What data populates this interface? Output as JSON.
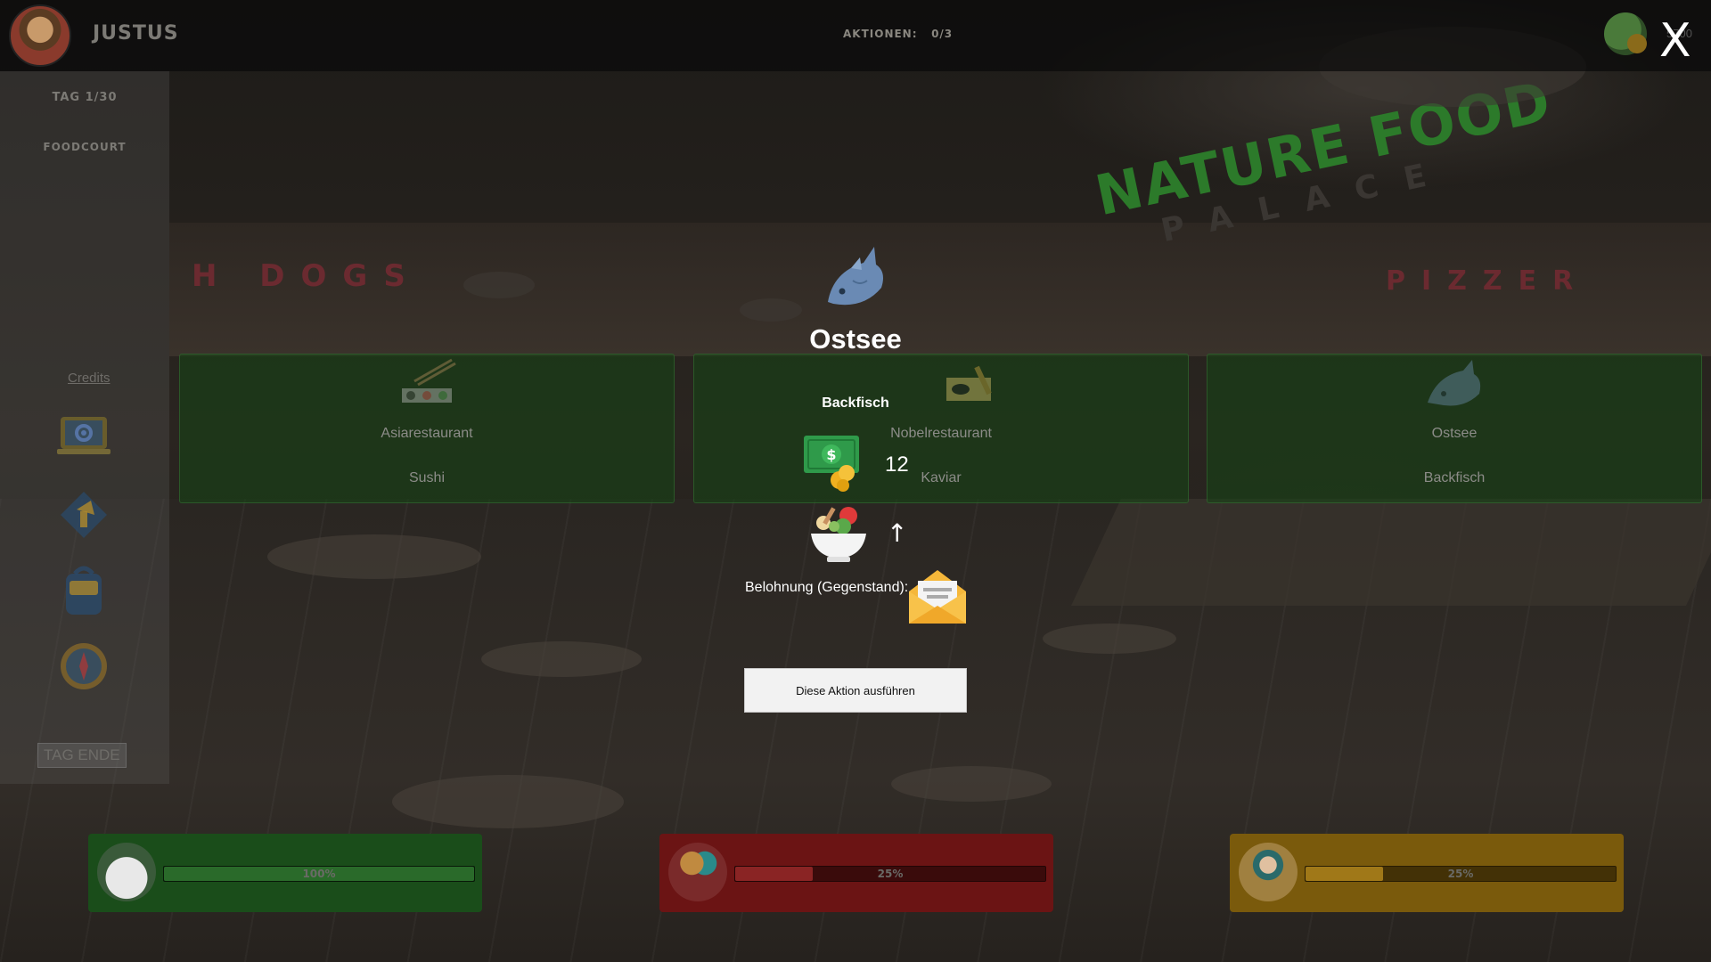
{
  "topbar": {
    "player_name": "JUSTUS",
    "actions_label": "AKTIONEN:",
    "actions_value": "0/3",
    "money": "5700",
    "close_label": "X"
  },
  "sidebar": {
    "day": "TAG 1/30",
    "location": "FOODCOURT",
    "credits": "Credits",
    "day_end": "TAG ENDE",
    "icons": [
      "settings-icon",
      "map-arrow-icon",
      "backpack-icon",
      "compass-icon"
    ]
  },
  "cards": [
    {
      "type": "Asiarestaurant",
      "item": "Sushi",
      "icon": "sushi-icon"
    },
    {
      "type": "Nobelrestaurant",
      "item": "Kaviar",
      "icon": "caviar-icon"
    },
    {
      "type": "Ostsee",
      "item": "Backfisch",
      "icon": "fish-icon"
    }
  ],
  "popup": {
    "title": "Ostsee",
    "item": "Backfisch",
    "cost": "12",
    "arrow": "↑",
    "reward_label": "Belohnung (Gegenstand):",
    "action_button": "Diese Aktion ausführen"
  },
  "stats": [
    {
      "name": "food",
      "label": "100%",
      "value": 1.0,
      "bg": "#1a4d1a",
      "fill": "#2a6a2a"
    },
    {
      "name": "fun",
      "label": "25%",
      "value": 0.25,
      "bg": "#6b1414",
      "fill": "#8a2424"
    },
    {
      "name": "social",
      "label": "25%",
      "value": 0.25,
      "bg": "#7a5a0c",
      "fill": "#a07818"
    }
  ],
  "colors": {
    "card_bg": "#1a4a1a",
    "accent_green": "#2c7a2a",
    "button_bg": "#f2f2f2"
  }
}
